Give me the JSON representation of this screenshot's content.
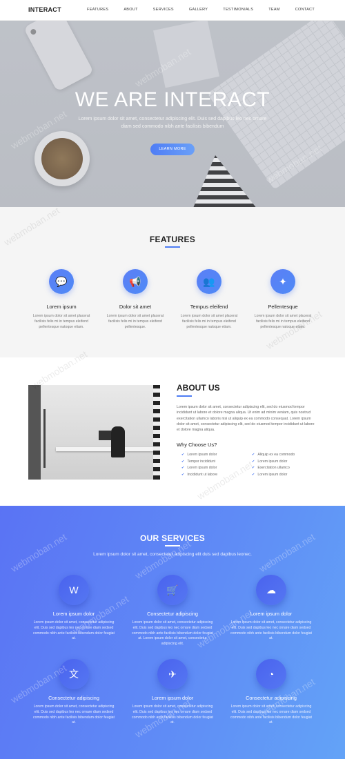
{
  "nav": {
    "brand": "INTERACT",
    "items": [
      "FEATURES",
      "ABOUT",
      "SERVICES",
      "GALLERY",
      "TESTIMONIALS",
      "TEAM",
      "CONTACT"
    ]
  },
  "hero": {
    "title": "WE ARE INTERACT",
    "subtitle": "Lorem ipsum dolor sit amet, consectetur adipiscing elit. Duis sed dapibus leo nec ornare diam sed commodo nibh ante facilisis bibendum",
    "button": "LEARN MORE"
  },
  "features": {
    "title": "FEATURES",
    "items": [
      {
        "icon": "chat-icon",
        "title": "Lorem ipsum",
        "text": "Lorem ipsum dolor sit amet placerat facilisis felis mi in tempus eleifend pellentesque natoque etiam."
      },
      {
        "icon": "megaphone-icon",
        "title": "Dolor sit amet",
        "text": "Lorem ipsum dolor sit amet placerat facilisis felis mi in tempus eleifend pellentesque."
      },
      {
        "icon": "users-icon",
        "title": "Tempus eleifend",
        "text": "Lorem ipsum dolor sit amet placerat facilisis felis mi in tempus eleifend pellentesque natoque etiam."
      },
      {
        "icon": "magic-wand-icon",
        "title": "Pellentesque",
        "text": "Lorem ipsum dolor sit amet placerat facilisis felis mi in tempus eleifend pellentesque natoque etiam."
      }
    ]
  },
  "about": {
    "title": "ABOUT US",
    "text": "Lorem ipsum dolor sit amet, consectetur adipiscing elit, sed do eiusmod tempor incididunt ut labore et dolore magna aliqua. Ut enim ad minim veniam, quis nostrud exercitation ullamco laboris nisi ut aliquip ex ea commodo consequat. Lorem ipsum dolor sit amet, consectetur adipiscing elit, sed do eiusmod tempor incididunt ut labore et dolore magna aliqua.",
    "why_title": "Why Choose Us?",
    "list_left": [
      "Lorem ipsum dolor",
      "Tempor incididunt",
      "Lorem ipsum dolor",
      "Incididunt ut labore"
    ],
    "list_right": [
      "Aliquip ex ea commodo",
      "Lorem ipsum dolor",
      "Exercitation ullamco",
      "Lorem ipsum dolor"
    ]
  },
  "services": {
    "title": "OUR SERVICES",
    "subtitle": "Lorem ipsum dolor sit amet, consectetur adipiscing elit duis sed dapibus leonec.",
    "items": [
      {
        "icon": "wordpress-icon",
        "glyph": "W",
        "title": "Lorem ipsum dolor",
        "text": "Lorem ipsum dolor sit amet, consectetur adipiscing elit. Duis sed dapibus leo nec ornare diam sedsed commodo nibh ante facilisis bibendum dolor feugiat at."
      },
      {
        "icon": "cart-icon",
        "glyph": "🛒",
        "title": "Consectetur adipiscing",
        "text": "Lorem ipsum dolor sit amet, consectetur adipiscing elit. Duis sed dapibus leo nec ornare diam sedsed commodo nibh ante facilisis bibendum dolor feugiat at. Lorem ipsum dolor sit amet, consectetur adipiscing elit."
      },
      {
        "icon": "cloud-download-icon",
        "glyph": "☁",
        "title": "Lorem ipsum dolor",
        "text": "Lorem ipsum dolor sit amet, consectetur adipiscing elit. Duis sed dapibus leo nec ornare diam sedsed commodo nibh ante facilisis bibendum dolor feugiat at."
      },
      {
        "icon": "translate-icon",
        "glyph": "文",
        "title": "Consectetur adipiscing",
        "text": "Lorem ipsum dolor sit amet, consectetur adipiscing elit. Duis sed dapibus leo nec ornare diam sedsed commodo nibh ante facilisis bibendum dolor feugiat at."
      },
      {
        "icon": "plane-icon",
        "glyph": "✈",
        "title": "Lorem ipsum dolor",
        "text": "Lorem ipsum dolor sit amet, consectetur adipiscing elit. Duis sed dapibus leo nec ornare diam sedsed commodo nibh ante facilisis bibendum dolor feugiat at."
      },
      {
        "icon": "pie-chart-icon",
        "glyph": "◔",
        "title": "Consectetur adipiscing",
        "text": "Lorem ipsum dolor sit amet, consectetur adipiscing elit. Duis sed dapibus leo nec ornare diam sedsed commodo nibh ante facilisis bibendum dolor feugiat at."
      }
    ]
  },
  "watermark": "webmoban.net",
  "colors": {
    "accent": "#4d7cf4",
    "services_start": "#5a73f4",
    "services_end": "#63a3f7"
  }
}
